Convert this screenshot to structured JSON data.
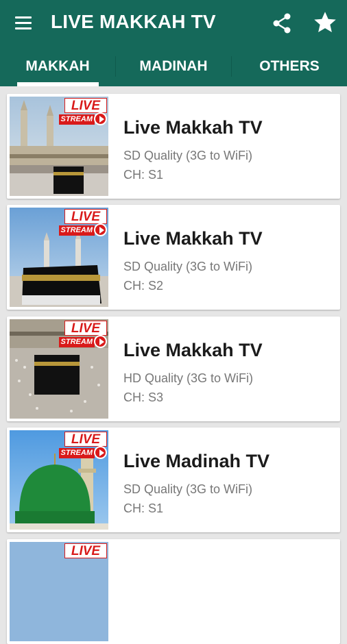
{
  "app": {
    "title": "LIVE MAKKAH TV",
    "colors": {
      "primary": "#15695a",
      "live_red": "#d91a1a",
      "background": "#e6e6e6"
    }
  },
  "toolbar": {
    "icons": [
      "menu-icon",
      "share-icon",
      "star-icon"
    ]
  },
  "tabs": [
    {
      "label": "MAKKAH",
      "selected": true
    },
    {
      "label": "MADINAH",
      "selected": false
    },
    {
      "label": "OTHERS",
      "selected": false
    }
  ],
  "badge": {
    "live": "LIVE",
    "stream": "STREAM"
  },
  "channels": [
    {
      "title": "Live Makkah TV",
      "quality": "SD Quality (3G to WiFi)",
      "channel": "CH: S1",
      "thumbnail": "makkah-minarets"
    },
    {
      "title": "Live Makkah TV",
      "quality": "SD Quality (3G to WiFi)",
      "channel": "CH: S2",
      "thumbnail": "kaaba-closeup"
    },
    {
      "title": "Live Makkah TV",
      "quality": "HD Quality (3G to WiFi)",
      "channel": "CH: S3",
      "thumbnail": "kaaba-crowd"
    },
    {
      "title": "Live Madinah TV",
      "quality": "SD Quality (3G to WiFi)",
      "channel": "CH: S1",
      "thumbnail": "green-dome"
    },
    {
      "title": "",
      "quality": "",
      "channel": "",
      "thumbnail": "makkah-partial"
    }
  ]
}
